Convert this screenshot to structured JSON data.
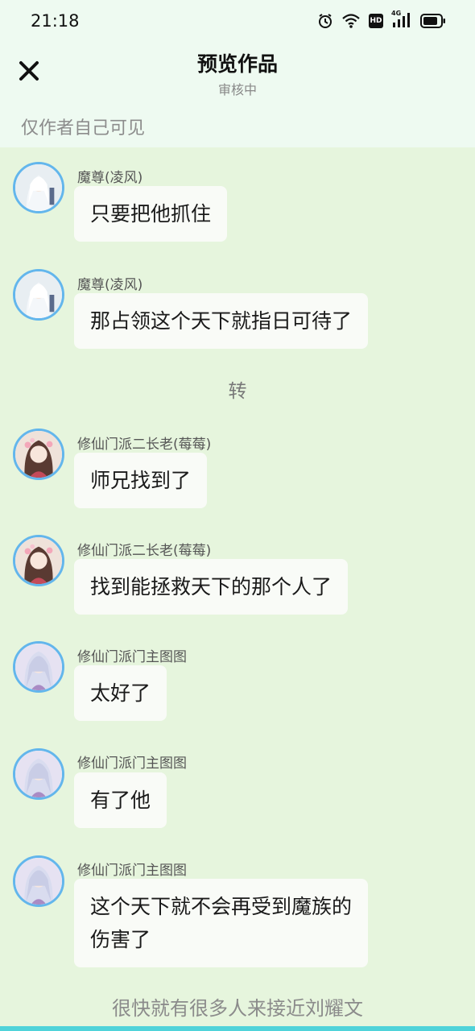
{
  "status_bar": {
    "time": "21:18",
    "icons": [
      "alarm-icon",
      "wifi-icon",
      "hd-icon",
      "signal-4g-icon",
      "battery-icon"
    ],
    "hd_label": "HD",
    "network_label": "4G"
  },
  "header": {
    "close_icon": "close-icon",
    "title": "预览作品",
    "subtitle": "审核中"
  },
  "visibility_note": "仅作者自己可见",
  "messages": [
    {
      "sender": "魔尊(凌风)",
      "text": "只要把他抓住",
      "avatar": "white-haired-man"
    },
    {
      "sender": "魔尊(凌风)",
      "text": "那占领这个天下就指日可待了",
      "avatar": "white-haired-man"
    },
    {
      "sender": "修仙门派二长老(莓莓)",
      "text": "师兄找到了",
      "avatar": "woman-with-flowers"
    },
    {
      "sender": "修仙门派二长老(莓莓)",
      "text": "找到能拯救天下的那个人了",
      "avatar": "woman-with-flowers"
    },
    {
      "sender": "修仙门派门主图图",
      "text": "太好了",
      "avatar": "silver-haired-master"
    },
    {
      "sender": "修仙门派门主图图",
      "text": "有了他",
      "avatar": "silver-haired-master"
    },
    {
      "sender": "修仙门派门主图图",
      "text_lines": [
        "这个天下就不会再受到魔族的",
        "伤害了"
      ],
      "avatar": "silver-haired-master"
    }
  ],
  "divider": "转",
  "footer_text": "很快就有很多人来接近刘耀文",
  "colors": {
    "page_background": "#e6f5dd",
    "header_background": "#eefaf1",
    "avatar_ring": "#63b6ec",
    "bubble": "#f9fbf7",
    "accent_strip": "#4fd3d9"
  }
}
